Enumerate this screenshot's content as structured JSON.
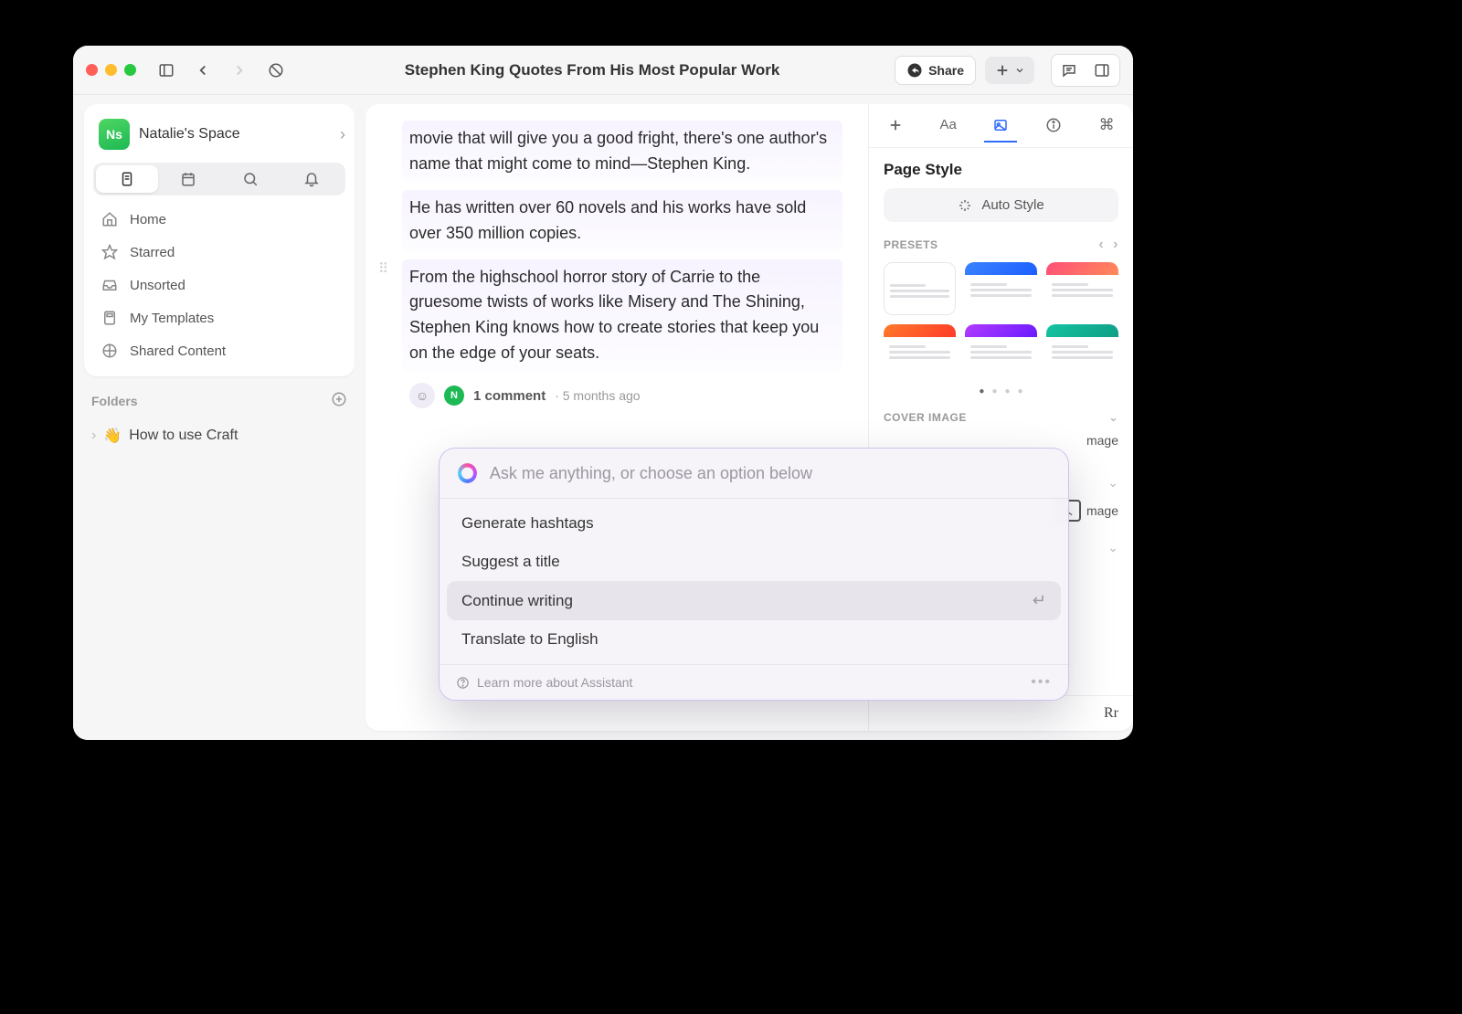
{
  "titlebar": {
    "doc_title": "Stephen King Quotes From His Most Popular Work",
    "share_label": "Share"
  },
  "sidebar": {
    "space_badge": "Ns",
    "space_name": "Natalie's Space",
    "nav": {
      "home": "Home",
      "starred": "Starred",
      "unsorted": "Unsorted",
      "templates": "My Templates",
      "shared": "Shared Content"
    },
    "folders_label": "Folders",
    "folder1_emoji": "👋",
    "folder1_name": "How to use Craft"
  },
  "doc": {
    "p1": "movie that will give you a good fright, there's one author's name that might come to mind—Stephen King.",
    "p2": "He has written over 60 novels and his works have sold over 350 million copies.",
    "p3": "From the highschool horror story of Carrie to the gruesome twists of works like Misery and The Shining, Stephen King knows how to create stories that keep you on the edge of your seats.",
    "comment_avatar": "N",
    "comment_label": "1 comment",
    "comment_date": "· 5 months ago"
  },
  "rpanel": {
    "page_style": "Page Style",
    "auto_style": "Auto Style",
    "presets_label": "PRESETS",
    "cover_label": "COVER IMAGE",
    "cover_option": "mage",
    "rr": "Rr"
  },
  "ai": {
    "placeholder": "Ask me anything, or choose an option below",
    "items": {
      "hashtags": "Generate hashtags",
      "title": "Suggest a title",
      "continue": "Continue writing",
      "translate": "Translate to English"
    },
    "learn_more": "Learn more about Assistant"
  }
}
